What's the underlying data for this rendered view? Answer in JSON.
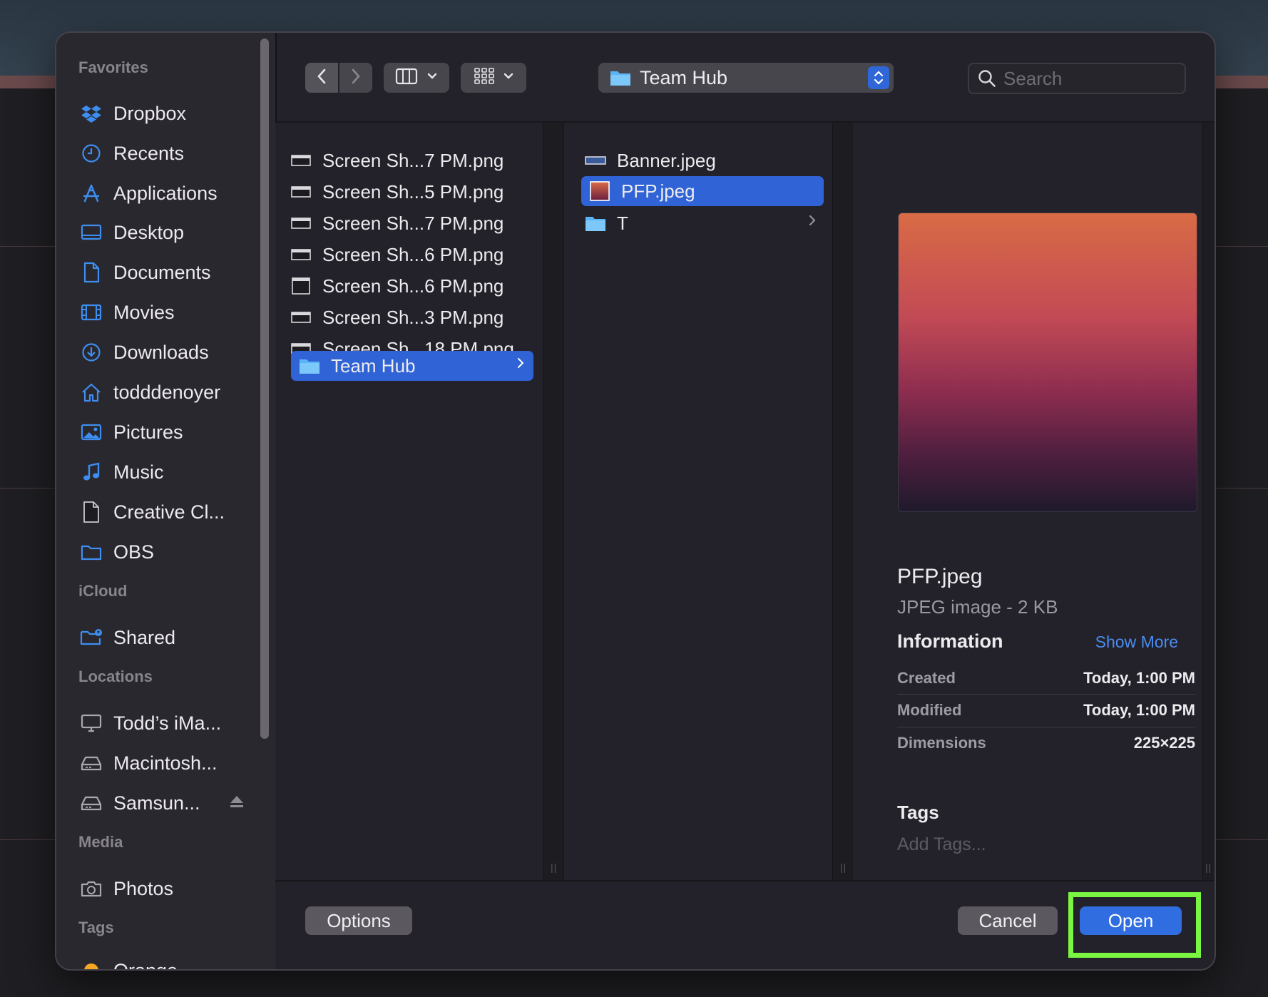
{
  "sidebar": {
    "sections": {
      "favorites": "Favorites",
      "icloud": "iCloud",
      "locations": "Locations",
      "media": "Media",
      "tags": "Tags"
    },
    "favorites": [
      {
        "label": "Dropbox",
        "icon": "dropbox-icon"
      },
      {
        "label": "Recents",
        "icon": "clock-icon"
      },
      {
        "label": "Applications",
        "icon": "applications-icon"
      },
      {
        "label": "Desktop",
        "icon": "desktop-icon"
      },
      {
        "label": "Documents",
        "icon": "document-icon"
      },
      {
        "label": "Movies",
        "icon": "film-icon"
      },
      {
        "label": "Downloads",
        "icon": "download-icon"
      },
      {
        "label": "todddenoyer",
        "icon": "home-icon"
      },
      {
        "label": "Pictures",
        "icon": "pictures-icon"
      },
      {
        "label": "Music",
        "icon": "music-note-icon"
      },
      {
        "label": "Creative Cl...",
        "icon": "file-icon"
      },
      {
        "label": "OBS",
        "icon": "folder-icon"
      }
    ],
    "icloud": [
      {
        "label": "Shared",
        "icon": "shared-folder-icon"
      }
    ],
    "locations": [
      {
        "label": "Todd’s iMa...",
        "icon": "computer-icon"
      },
      {
        "label": "Macintosh...",
        "icon": "disk-icon"
      },
      {
        "label": "Samsun...",
        "icon": "disk-icon"
      }
    ],
    "media": [
      {
        "label": "Photos",
        "icon": "camera-icon"
      }
    ],
    "tags": [
      {
        "label": "Orange",
        "color": "#f5a623"
      }
    ]
  },
  "toolbar": {
    "path": "Team Hub",
    "search_placeholder": "Search"
  },
  "column1": [
    {
      "name": "Screen Sh...7 PM.png"
    },
    {
      "name": "Screen Sh...5 PM.png"
    },
    {
      "name": "Screen Sh...7 PM.png"
    },
    {
      "name": "Screen Sh...6 PM.png"
    },
    {
      "name": "Screen Sh...6 PM.png"
    },
    {
      "name": "Screen Sh...3 PM.png"
    },
    {
      "name": "Screen Sh...18 PM.png"
    },
    {
      "name": "Team Hub"
    }
  ],
  "column2": [
    {
      "name": "Banner.jpeg"
    },
    {
      "name": "PFP.jpeg"
    },
    {
      "name": "T"
    }
  ],
  "preview": {
    "name": "PFP.jpeg",
    "kind": "JPEG image - 2 KB",
    "info_title": "Information",
    "show_more": "Show More",
    "rows": [
      {
        "key": "Created",
        "value": "Today, 1:00 PM"
      },
      {
        "key": "Modified",
        "value": "Today, 1:00 PM"
      },
      {
        "key": "Dimensions",
        "value": "225×225"
      }
    ],
    "tags_title": "Tags",
    "add_tags": "Add Tags..."
  },
  "buttons": {
    "options": "Options",
    "cancel": "Cancel",
    "open": "Open"
  },
  "colors": {
    "accent": "#2f6de0",
    "highlight": "#7af542",
    "selection": "#2f63d6"
  }
}
